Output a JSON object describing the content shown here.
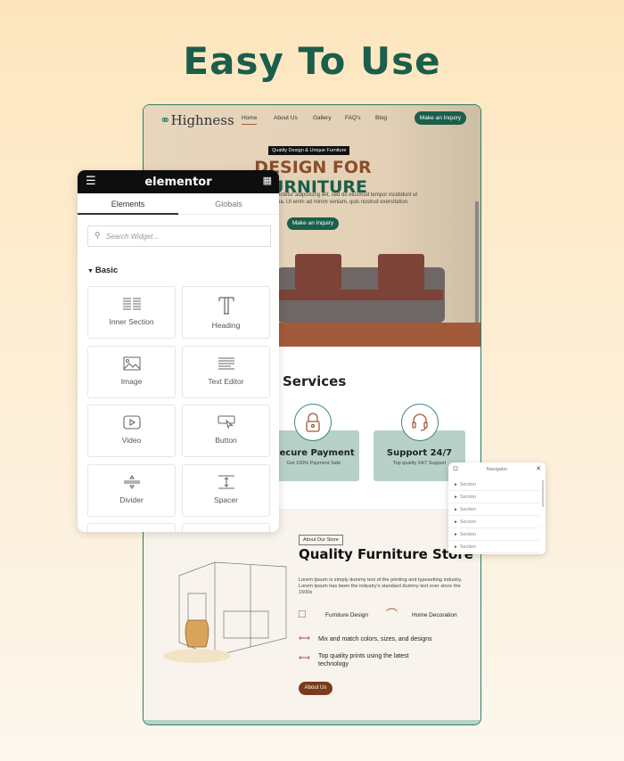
{
  "headline": "Easy To Use",
  "site": {
    "logo": "Highness",
    "nav": [
      "Home",
      "About Us",
      "Gallery",
      "FAQ's",
      "Blog"
    ],
    "cta": "Make an Inquiry",
    "badge": "Quality Design & Unique Furniture",
    "hero_title_a": "DESIGN FOR ",
    "hero_title_b": "FURNITURE",
    "hero_desc_1": "ectetur adipisicing elit, sed do eiusmod tempor incididunt ut",
    "hero_desc_2": "ua. Ut enim ad minim veniam, quis nostrud exercitation.",
    "hero_button": "Make an Inquiry",
    "services_title": "Services",
    "services": [
      {
        "title": "Secure Payment",
        "sub": "Got 100% Payment Safe",
        "icon": "lock-icon"
      },
      {
        "title": "Support 24/7",
        "sub": "Top quality 24/7 Support",
        "icon": "headset-icon"
      }
    ],
    "about_badge": "About Our Store",
    "about_title": "Quality Furniture Store",
    "about_desc": "Lorem Ipsum is simply dummy text of the printing and typesetting industry. Lorem Ipsum has been the industry's standard dummy text ever since the 1500s",
    "features": [
      "Furniture Design",
      "Home Decoration"
    ],
    "bullets": [
      "Mix and match colors, sizes, and designs",
      "Top quality prints using the latest technology"
    ],
    "about_button": "About Us"
  },
  "elementor": {
    "brand": "elementor",
    "tabs": [
      "Elements",
      "Globals"
    ],
    "search_placeholder": "Search Widget...",
    "category": "Basic",
    "widgets": [
      "Inner Section",
      "Heading",
      "Image",
      "Text Editor",
      "Video",
      "Button",
      "Divider",
      "Spacer"
    ]
  },
  "navigator": {
    "title": "Navigator",
    "items": [
      "Section",
      "Section",
      "Section",
      "Section",
      "Section",
      "Section"
    ]
  },
  "colors": {
    "brand_green": "#1b5e4b",
    "brand_brown": "#8c4d2b",
    "card_teal": "#b7d1c8"
  }
}
